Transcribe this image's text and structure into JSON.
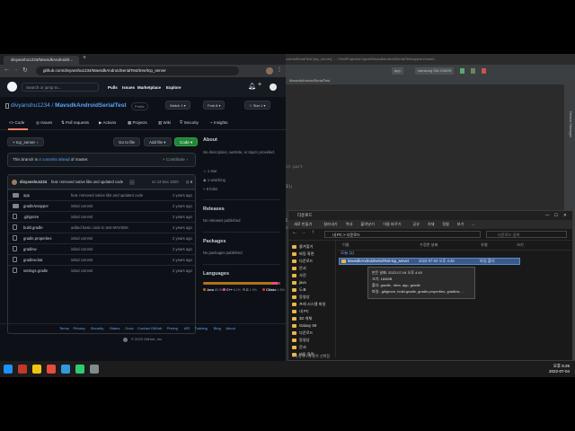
{
  "browser": {
    "tab_title": "divyanshu1234/MavsdkAndroidS...",
    "url": "github.com/divyanshu1234/MavsdkAndroidSerialTest/tree/tcp_server"
  },
  "github": {
    "search_placeholder": "Search or jump to...",
    "nav": [
      "Pulls",
      "Issues",
      "Marketplace",
      "Explore"
    ],
    "repo_owner": "divyanshu1234",
    "repo_sep": " / ",
    "repo_name": "MavsdkAndroidSerialTest",
    "visibility": "Public",
    "watch_label": "Watch",
    "watch_count": "1",
    "fork_label": "Fork",
    "fork_count": "8",
    "star_label": "Star",
    "star_count": "1",
    "tabs": [
      "Code",
      "Issues",
      "Pull requests",
      "Actions",
      "Projects",
      "Wiki",
      "Security",
      "Insights"
    ],
    "branch": "tcp_server",
    "goto_file": "Go to file",
    "add_file": "Add file",
    "code_button": "Code",
    "notice_prefix": "This branch is ",
    "notice_link": "4 commits ahead",
    "notice_suffix": " of master.",
    "contribute": "Contribute",
    "commit": {
      "author": "divyanshu1234",
      "message": "feat: removed native libs and updated code",
      "ellipsis": "...",
      "date": "on 13 Dec 2020",
      "count": "6"
    },
    "files": [
      {
        "name": "app",
        "type": "folder",
        "message": "feat: removed native libs and updated code",
        "date": "2 years ago"
      },
      {
        "name": "gradle/wrapper",
        "type": "folder",
        "message": "initial commit",
        "date": "2 years ago"
      },
      {
        "name": ".gitignore",
        "type": "file",
        "message": "initial commit",
        "date": "2 years ago"
      },
      {
        "name": "build.gradle",
        "type": "file",
        "message": "added basic code to test MAVSDK",
        "date": "2 years ago"
      },
      {
        "name": "gradle.properties",
        "type": "file",
        "message": "initial commit",
        "date": "2 years ago"
      },
      {
        "name": "gradlew",
        "type": "file",
        "message": "initial commit",
        "date": "2 years ago"
      },
      {
        "name": "gradlew.bat",
        "type": "file",
        "message": "initial commit",
        "date": "2 years ago"
      },
      {
        "name": "settings.gradle",
        "type": "file",
        "message": "initial commit",
        "date": "2 years ago"
      }
    ],
    "about": {
      "heading": "About",
      "description": "No description, website, or topics provided.",
      "stars": "1 star",
      "watching": "1 watching",
      "forks": "8 forks"
    },
    "releases": {
      "heading": "Releases",
      "text": "No releases published"
    },
    "packages": {
      "heading": "Packages",
      "text": "No packages published"
    },
    "languages": {
      "heading": "Languages",
      "items": [
        {
          "name": "Java",
          "percent": "80.5%",
          "value": 80.5,
          "color": "#b07219"
        },
        {
          "name": "C++",
          "percent": "6.1%",
          "value": 6.1,
          "color": "#f34b7d"
        },
        {
          "name": "C",
          "percent": "1.9%",
          "value": 1.9,
          "color": "#555555"
        },
        {
          "name": "CMake",
          "percent": "1.5%",
          "value": 1.5,
          "color": "#da3434"
        }
      ]
    },
    "footer": [
      "Terms",
      "Privacy",
      "Security",
      "Status",
      "Docs",
      "Contact GitHub",
      "Pricing",
      "API",
      "Training",
      "Blog",
      "About"
    ],
    "copyright": "© 2022 GitHub, Inc."
  },
  "ide": {
    "title": "AndroidSerialTest [tcp_server] - ...\\TestProject\\src\\java\\MavsdkAndroidSerialTest\\app\\src\\main\\...",
    "device_run": "app",
    "device": "samsung SM-G960N",
    "breadcrumb": "MavsdkAndroidSerialTest",
    "code_lines": [
      {
        "text": "it part",
        "color": "#808080"
      },
      {
        "text": "1);",
        "color": "#a9b7c6"
      },
      {
        "text": "Context.USB_SERVICE);",
        "color": "#a9b7c6"
      },
      {
        "text": "r().findAllDrivers(usbManager);",
        "color": "#a9b7c6"
      }
    ],
    "side_label": "Device Manager"
  },
  "explorer": {
    "title": "다운로드",
    "ribbon": [
      "새로 만들기",
      "잘라내기",
      "복사",
      "붙여넣기",
      "이름 바꾸기",
      "공유",
      "삭제",
      "정렬",
      "보기",
      "..."
    ],
    "address": "내 PC  >  다운로드",
    "search_placeholder": "다운로드 검색",
    "columns": [
      "이름",
      "수정한 날짜",
      "유형",
      "크기"
    ],
    "group": "오늘 (1)",
    "selected_file": "MavsdkAndroidSerialTest-tcp_server",
    "selected_date": "2022-07-04 오후 4:45",
    "selected_type": "파일 폴더",
    "tooltip": [
      "만든 날짜: 2022-07-04 오후 4:45",
      "크기: 184MB",
      "폴더: gradle, .idea, app, gradle",
      "파일: .gitignore, build.gradle, gradle.properties, gradlew, ..."
    ],
    "nav": [
      "즐겨찾기",
      "바탕 화면",
      "다운로드",
      "문서",
      "사진",
      "java",
      "도표",
      "동영상",
      "프레 시스템 파일",
      "내 PC",
      "3D 개체",
      "Galaxy S9",
      "다운로드",
      "동영상",
      "문서",
      "바탕 화면"
    ],
    "status": "1개 항목   1개 항목 선택함"
  },
  "taskbar": {
    "time": "오후 5:26",
    "date": "2022-07-04"
  }
}
